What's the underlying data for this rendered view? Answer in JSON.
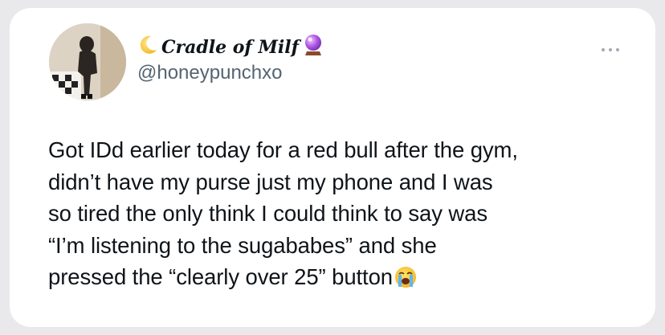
{
  "tweet": {
    "author": {
      "display_name": "Cradle of Milf",
      "name_prefix_icon": "crescent-moon-icon",
      "name_suffix_icon": "crystal-ball-icon",
      "handle": "@honeypunchxo"
    },
    "more_icon": "more-options-icon",
    "text_lines": [
      "Got IDd earlier today for a red bull after the gym,",
      "didn’t have my purse just my phone and I was",
      "so tired the only think I could think to say was",
      "“I’m listening to the sugababes” and she",
      "pressed the “clearly over 25” button"
    ],
    "trailing_emoji": "loudly-crying-face-icon"
  },
  "colors": {
    "text": "#0f1419",
    "handle": "#536471",
    "card": "#ffffff",
    "background": "#e9e9ec"
  }
}
